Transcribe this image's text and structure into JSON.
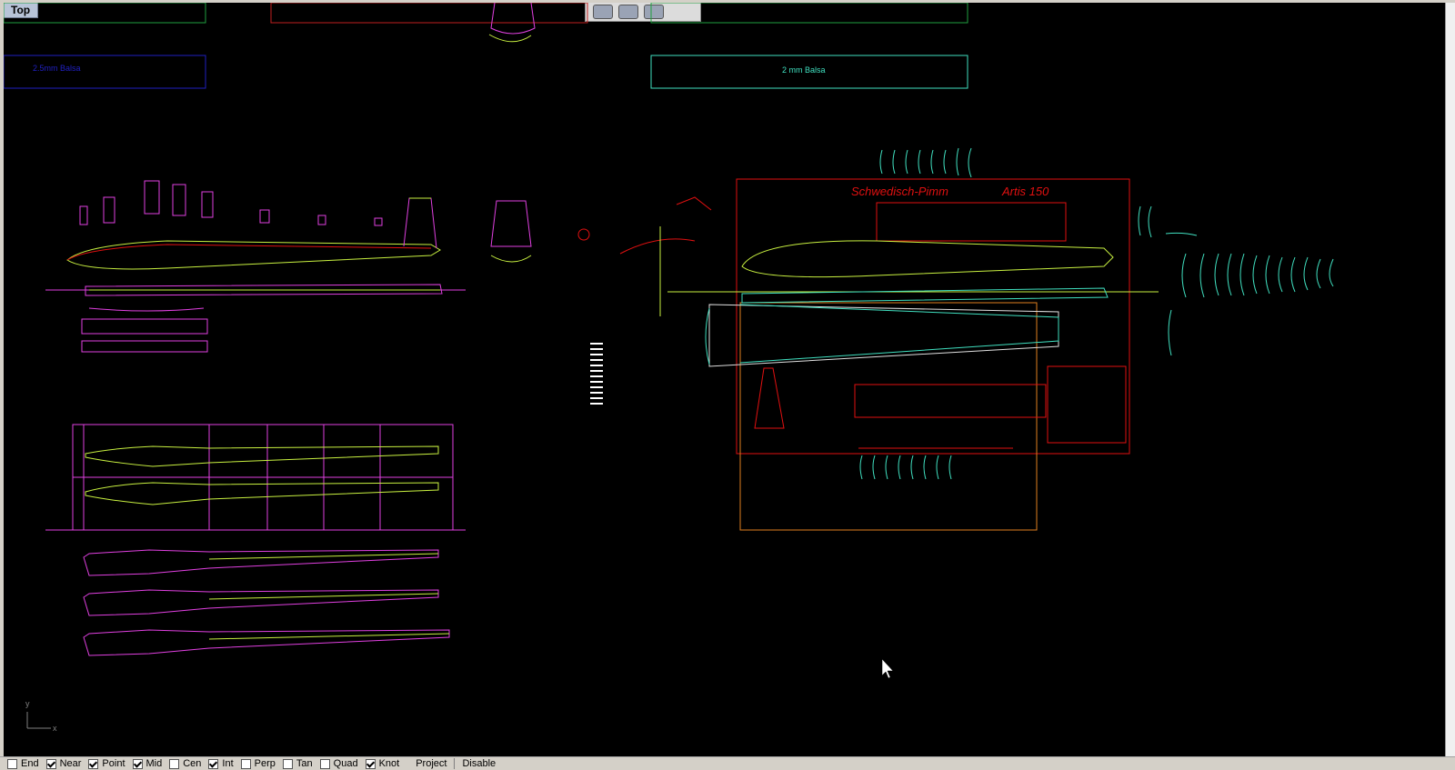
{
  "viewport": {
    "title": "Top",
    "axis": {
      "y": "y",
      "x": "x"
    }
  },
  "labels": {
    "balsa_left": "2.5mm Balsa",
    "balsa_right": "2 mm Balsa",
    "plan_title": "Schwedisch-Pimm",
    "plan_model": "Artis 150"
  },
  "colors": {
    "background": "#000000",
    "magenta": "#e040e0",
    "red": "#e01010",
    "yellow_green": "#c8f040",
    "cyan": "#40e0c0",
    "blue": "#2020c0",
    "orange": "#e08020"
  },
  "osnaps": [
    {
      "label": "End",
      "checked": false
    },
    {
      "label": "Near",
      "checked": true
    },
    {
      "label": "Point",
      "checked": true
    },
    {
      "label": "Mid",
      "checked": true
    },
    {
      "label": "Cen",
      "checked": false
    },
    {
      "label": "Int",
      "checked": true
    },
    {
      "label": "Perp",
      "checked": false
    },
    {
      "label": "Tan",
      "checked": false
    },
    {
      "label": "Quad",
      "checked": false
    },
    {
      "label": "Knot",
      "checked": true
    },
    {
      "label": "Project",
      "checked": null
    },
    {
      "label": "Disable",
      "checked": null
    }
  ]
}
